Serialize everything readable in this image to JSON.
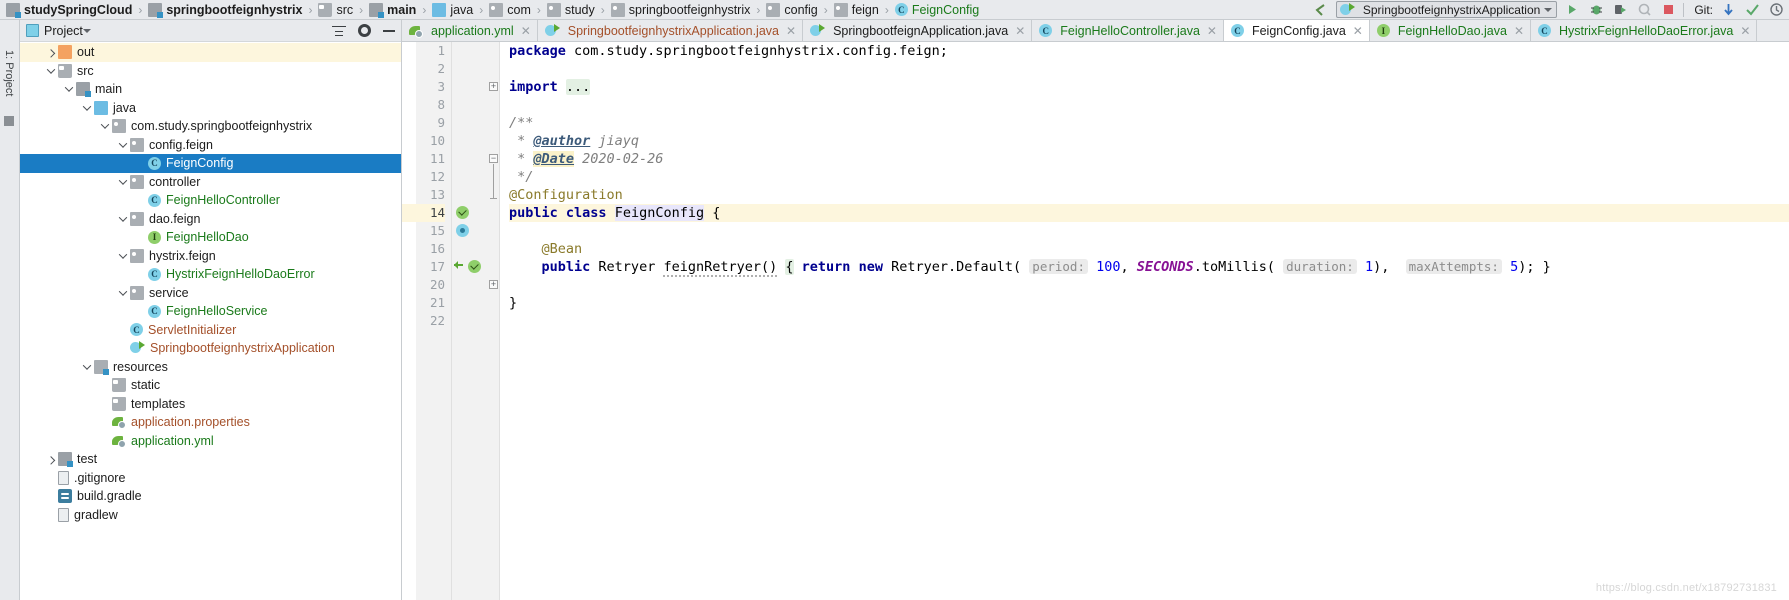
{
  "breadcrumb": {
    "items": [
      {
        "label": "studySpringCloud",
        "icon": "module-icon",
        "style": "bold"
      },
      {
        "label": "springbootfeignhystrix",
        "icon": "module-icon",
        "style": "bold"
      },
      {
        "label": "src",
        "icon": "folder-gray-icon",
        "style": "normal"
      },
      {
        "label": "main",
        "icon": "module-icon",
        "style": "bold"
      },
      {
        "label": "java",
        "icon": "folder-blue-icon",
        "style": "normal"
      },
      {
        "label": "com",
        "icon": "package-icon",
        "style": "normal"
      },
      {
        "label": "study",
        "icon": "package-icon",
        "style": "normal"
      },
      {
        "label": "springbootfeignhystrix",
        "icon": "package-icon",
        "style": "normal"
      },
      {
        "label": "config",
        "icon": "package-icon",
        "style": "normal"
      },
      {
        "label": "feign",
        "icon": "package-icon",
        "style": "normal"
      },
      {
        "label": "FeignConfig",
        "icon": "class-icon",
        "style": "green"
      }
    ],
    "separator": "›"
  },
  "toolbar": {
    "back_arrow_icon": "back-arrow-icon",
    "run_configuration": "SpringbootfeignhystrixApplication",
    "run_icon": "run-icon",
    "debug_icon": "debug-icon",
    "run_coverage_icon": "run-with-coverage-icon",
    "profile_icon": "profile-icon",
    "stop_icon": "stop-icon",
    "git_label": "Git:",
    "git_update_icon": "update-project-icon",
    "git_commit_icon": "commit-icon",
    "git_history_icon": "history-icon"
  },
  "project_panel": {
    "title": "Project",
    "tool_window_label": "1: Project",
    "collapse_all_icon": "collapse-all-icon",
    "settings_icon": "gear-icon",
    "hide_icon": "minus-icon",
    "tree": [
      {
        "label": "out",
        "indent": 1,
        "twist": "right",
        "icon": "folder-orange-icon",
        "color": "dark",
        "state": "highlight"
      },
      {
        "label": "src",
        "indent": 1,
        "twist": "down",
        "icon": "folder-gray-icon",
        "color": "dark",
        "state": "normal"
      },
      {
        "label": "main",
        "indent": 2,
        "twist": "down",
        "icon": "module-icon",
        "color": "dark",
        "state": "normal"
      },
      {
        "label": "java",
        "indent": 3,
        "twist": "down",
        "icon": "folder-blue-icon",
        "color": "dark",
        "state": "normal"
      },
      {
        "label": "com.study.springbootfeignhystrix",
        "indent": 4,
        "twist": "down",
        "icon": "package-icon",
        "color": "dark",
        "state": "normal"
      },
      {
        "label": "config.feign",
        "indent": 5,
        "twist": "down",
        "icon": "package-icon",
        "color": "dark",
        "state": "normal"
      },
      {
        "label": "FeignConfig",
        "indent": 6,
        "twist": "none",
        "icon": "class-icon",
        "color": "green",
        "state": "selected"
      },
      {
        "label": "controller",
        "indent": 5,
        "twist": "down",
        "icon": "package-icon",
        "color": "dark",
        "state": "normal"
      },
      {
        "label": "FeignHelloController",
        "indent": 6,
        "twist": "none",
        "icon": "class-icon",
        "color": "green",
        "state": "normal"
      },
      {
        "label": "dao.feign",
        "indent": 5,
        "twist": "down",
        "icon": "package-icon",
        "color": "dark",
        "state": "normal"
      },
      {
        "label": "FeignHelloDao",
        "indent": 6,
        "twist": "none",
        "icon": "interface-icon",
        "color": "green",
        "state": "normal"
      },
      {
        "label": "hystrix.feign",
        "indent": 5,
        "twist": "down",
        "icon": "package-icon",
        "color": "dark",
        "state": "normal"
      },
      {
        "label": "HystrixFeignHelloDaoError",
        "indent": 6,
        "twist": "none",
        "icon": "class-icon",
        "color": "green",
        "state": "normal"
      },
      {
        "label": "service",
        "indent": 5,
        "twist": "down",
        "icon": "package-icon",
        "color": "dark",
        "state": "normal"
      },
      {
        "label": "FeignHelloService",
        "indent": 6,
        "twist": "none",
        "icon": "class-icon",
        "color": "green",
        "state": "normal"
      },
      {
        "label": "ServletInitializer",
        "indent": 5,
        "twist": "none",
        "icon": "class-icon",
        "color": "brown",
        "state": "normal"
      },
      {
        "label": "SpringbootfeignhystrixApplication",
        "indent": 5,
        "twist": "none",
        "icon": "spring-app-icon",
        "color": "brown",
        "state": "normal"
      },
      {
        "label": "resources",
        "indent": 3,
        "twist": "down",
        "icon": "resources-icon",
        "color": "dark",
        "state": "normal"
      },
      {
        "label": "static",
        "indent": 4,
        "twist": "none",
        "icon": "folder-gray-icon",
        "color": "dark",
        "state": "normal"
      },
      {
        "label": "templates",
        "indent": 4,
        "twist": "none",
        "icon": "folder-gray-icon",
        "color": "dark",
        "state": "normal"
      },
      {
        "label": "application.properties",
        "indent": 4,
        "twist": "none",
        "icon": "spring-file-icon",
        "color": "brown",
        "state": "normal"
      },
      {
        "label": "application.yml",
        "indent": 4,
        "twist": "none",
        "icon": "spring-file-icon",
        "color": "green",
        "state": "normal"
      },
      {
        "label": "test",
        "indent": 1,
        "twist": "right",
        "icon": "module-icon",
        "color": "dark",
        "state": "normal"
      },
      {
        "label": ".gitignore",
        "indent": 1,
        "twist": "none",
        "icon": "file-icon",
        "color": "dark",
        "state": "normal"
      },
      {
        "label": "build.gradle",
        "indent": 1,
        "twist": "none",
        "icon": "gradle-icon",
        "color": "dark",
        "state": "normal"
      },
      {
        "label": "gradlew",
        "indent": 1,
        "twist": "none",
        "icon": "file-icon",
        "color": "dark",
        "state": "normal"
      }
    ]
  },
  "editor_tabs": [
    {
      "label": "application.yml",
      "icon": "spring-file-icon",
      "color": "green",
      "active": false
    },
    {
      "label": "SpringbootfeignhystrixApplication.java",
      "icon": "spring-app-icon",
      "color": "brown",
      "active": false
    },
    {
      "label": "SpringbootfeignApplication.java",
      "icon": "spring-app-icon",
      "color": "dark",
      "active": false
    },
    {
      "label": "FeignHelloController.java",
      "icon": "class-icon",
      "color": "green",
      "active": false
    },
    {
      "label": "FeignConfig.java",
      "icon": "class-icon",
      "color": "dark",
      "active": true
    },
    {
      "label": "FeignHelloDao.java",
      "icon": "interface-icon",
      "color": "green",
      "active": false
    },
    {
      "label": "HystrixFeignHelloDaoError.java",
      "icon": "class-icon",
      "color": "green",
      "active": false
    }
  ],
  "code": {
    "line_numbers": [
      "1",
      "2",
      "3",
      "8",
      "9",
      "10",
      "11",
      "12",
      "13",
      "14",
      "15",
      "16",
      "17",
      "20",
      "21",
      "22"
    ],
    "current_line": "14",
    "lines": [
      {
        "n": "1",
        "text": "package com.study.springbootfeignhystrix.config.feign;"
      },
      {
        "n": "2",
        "text": ""
      },
      {
        "n": "3",
        "text": "import ..."
      },
      {
        "n": "8",
        "text": ""
      },
      {
        "n": "9",
        "text": "/**"
      },
      {
        "n": "10",
        "text": " * @author jiayq"
      },
      {
        "n": "11",
        "text": " * @Date 2020-02-26"
      },
      {
        "n": "12",
        "text": " */"
      },
      {
        "n": "13",
        "text": "@Configuration"
      },
      {
        "n": "14",
        "text": "public class FeignConfig {"
      },
      {
        "n": "15",
        "text": ""
      },
      {
        "n": "16",
        "text": "    @Bean"
      },
      {
        "n": "17",
        "text": "    public Retryer feignRetryer() { return new Retryer.Default( period: 100, SECONDS.toMillis( duration: 1),  maxAttempts: 5); }"
      },
      {
        "n": "20",
        "text": ""
      },
      {
        "n": "21",
        "text": "}"
      },
      {
        "n": "22",
        "text": ""
      }
    ],
    "tokens": {
      "kw_package": "package",
      "pkg_name": "com.study.springbootfeignhystrix.config.feign;",
      "kw_import": "import",
      "import_fold": "...",
      "doc_open": "/**",
      "doc_star": " * ",
      "tag_author": "@author",
      "author_name": " jiayq",
      "tag_date": "@Date",
      "date_value": " 2020-02-26",
      "doc_close": " */",
      "anno_configuration": "@Configuration",
      "kw_public": "public",
      "kw_class": "class",
      "class_name": "FeignConfig",
      "brace_open": "{",
      "anno_bean": "@Bean",
      "ret_type": "Retryer",
      "method_name": "feignRetryer()",
      "kw_return": "return",
      "kw_new": "new",
      "ctor": "Retryer.Default(",
      "hint_period": "period:",
      "val_period": "100",
      "static_seconds": "SECONDS",
      "to_millis": ".toMillis(",
      "hint_duration": "duration:",
      "val_duration": "1",
      "hint_max": "maxAttempts:",
      "val_max": "5",
      "close_stmt": "); }",
      "brace_close": "}"
    }
  },
  "watermark": "https://blog.csdn.net/x18792731831",
  "colors": {
    "selection_blue": "#1a7cc4",
    "current_line_yellow": "#fdf6dd",
    "toolbar_gray": "#e8eaed",
    "green_text": "#1a7a1a",
    "brown_text": "#a4502a",
    "keyword_blue": "#00008f",
    "annotation_olive": "#8a7a2a",
    "number_blue": "#0000ee",
    "static_purple": "#871094"
  }
}
